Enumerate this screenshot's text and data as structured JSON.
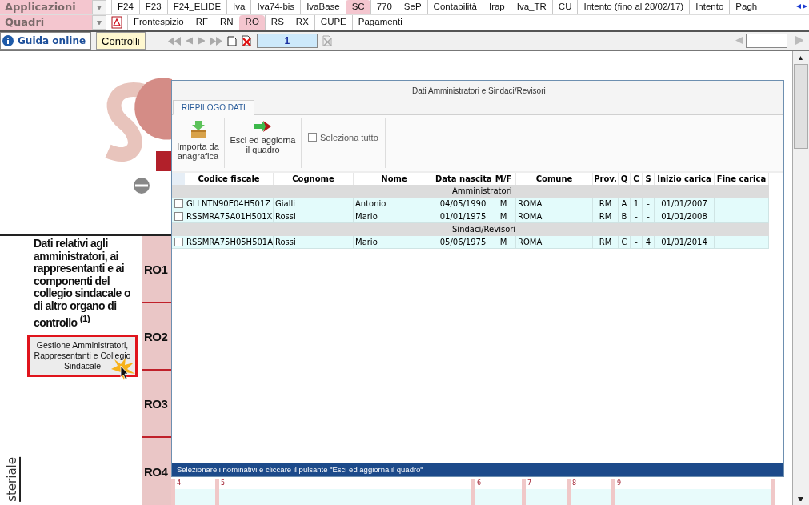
{
  "app_bar": {
    "label": "Applicazioni",
    "tabs": [
      {
        "label": "F24",
        "selected": false
      },
      {
        "label": "F23",
        "selected": false
      },
      {
        "label": "F24_ELIDE",
        "selected": false
      },
      {
        "label": "Iva",
        "selected": false
      },
      {
        "label": "Iva74-bis",
        "selected": false
      },
      {
        "label": "IvaBase",
        "selected": false
      },
      {
        "label": "SC",
        "selected": true
      },
      {
        "label": "770",
        "selected": false
      },
      {
        "label": "SeP",
        "selected": false
      },
      {
        "label": "Contabilità",
        "selected": false
      },
      {
        "label": "Irap",
        "selected": false
      },
      {
        "label": "Iva_TR",
        "selected": false
      },
      {
        "label": "CU",
        "selected": false
      },
      {
        "label": "Intento (fino al 28/02/17)",
        "selected": false
      },
      {
        "label": "Intento",
        "selected": false
      },
      {
        "label": "Pagh",
        "selected": false
      }
    ]
  },
  "quadri_bar": {
    "label": "Quadri",
    "tabs": [
      {
        "label": "Frontespizio",
        "selected": false
      },
      {
        "label": "RF",
        "selected": false
      },
      {
        "label": "RN",
        "selected": false
      },
      {
        "label": "RO",
        "selected": true
      },
      {
        "label": "RS",
        "selected": false
      },
      {
        "label": "RX",
        "selected": false
      },
      {
        "label": "CUPE",
        "selected": false
      },
      {
        "label": "Pagamenti",
        "selected": false
      }
    ]
  },
  "toolbar": {
    "help_button": "Guida online",
    "controls_button": "Controlli",
    "page_number": "1"
  },
  "form": {
    "section_title": "Dati relativi agli amministratori, ai rappresentanti e ai componenti del collegio sindacale o di altro organo di controllo $^{(1)}$",
    "manage_button": "Gestione Amministratori, Rappresentanti e Collegio Sindacale",
    "rows": [
      "RO1",
      "RO2",
      "RO3",
      "RO4"
    ],
    "field_numbers": [
      "4",
      "5",
      "6",
      "7",
      "8",
      "9"
    ],
    "side_text": "steriale"
  },
  "dialog": {
    "title": "Dati Amministratori e Sindaci/Revisori",
    "tabs": [
      {
        "label": "RIEPILOGO DATI",
        "selected": true
      }
    ],
    "actions": [
      {
        "kind": "import",
        "label": "Importa da anagrafica"
      },
      {
        "kind": "exit",
        "label": "Esci ed aggiorna il quadro"
      }
    ],
    "select_all": {
      "label": "Seleziona tutto",
      "checked": false
    },
    "columns": [
      "Codice fiscale",
      "Cognome",
      "Nome",
      "Data nascita",
      "M/F",
      "Comune",
      "Prov.",
      "Q",
      "C",
      "S",
      "Inizio carica",
      "Fine carica"
    ],
    "groups": [
      {
        "title": "Amministratori",
        "rows": [
          {
            "checked": false,
            "cells": [
              "GLLNTN90E04H501Z",
              "Gialli",
              "Antonio",
              "04/05/1990",
              "M",
              "ROMA",
              "RM",
              "A",
              "1",
              "-",
              "01/01/2007"
            ]
          },
          {
            "checked": false,
            "cells": [
              "RSSMRA75A01H501X",
              "Rossi",
              "Mario",
              "01/01/1975",
              "M",
              "ROMA",
              "RM",
              "B",
              "-",
              "-",
              "01/01/2008"
            ]
          }
        ]
      },
      {
        "title": "Sindaci/Revisori",
        "rows": [
          {
            "checked": false,
            "cells": [
              "RSSMRA75H05H501A",
              "Rossi",
              "Mario",
              "05/06/1975",
              "M",
              "ROMA",
              "RM",
              "C",
              "-",
              "4",
              "01/01/2014"
            ]
          }
        ]
      }
    ],
    "status": "Selezionare i nominativi e cliccare il pulsante \"Esci ed aggiorna il quadro\""
  }
}
